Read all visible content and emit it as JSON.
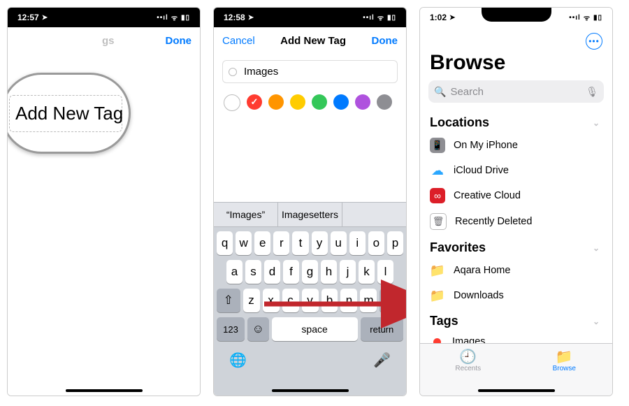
{
  "panel1": {
    "time": "12:57",
    "nav_done": "Done",
    "title_fragment": "gs",
    "magnified_text": "Add New Tag"
  },
  "panel2": {
    "time": "12:58",
    "nav_cancel": "Cancel",
    "nav_title": "Add New Tag",
    "nav_done": "Done",
    "input_value": "Images",
    "colors": [
      {
        "name": "none",
        "hex": "#ffffff",
        "hollow": true,
        "selected": false
      },
      {
        "name": "red",
        "hex": "#ff3b30",
        "selected": true
      },
      {
        "name": "orange",
        "hex": "#ff9500",
        "selected": false
      },
      {
        "name": "yellow",
        "hex": "#ffcc00",
        "selected": false
      },
      {
        "name": "green",
        "hex": "#34c759",
        "selected": false
      },
      {
        "name": "blue",
        "hex": "#007aff",
        "selected": false
      },
      {
        "name": "purple",
        "hex": "#af52de",
        "selected": false
      },
      {
        "name": "gray",
        "hex": "#8e8e93",
        "selected": false
      }
    ],
    "suggestions": [
      "“Images”",
      "Imagesetters",
      ""
    ],
    "kb_row1": [
      "q",
      "w",
      "e",
      "r",
      "t",
      "y",
      "u",
      "i",
      "o",
      "p"
    ],
    "kb_row2": [
      "a",
      "s",
      "d",
      "f",
      "g",
      "h",
      "j",
      "k",
      "l"
    ],
    "kb_row3": [
      "z",
      "x",
      "c",
      "v",
      "b",
      "n",
      "m"
    ],
    "kb_shift": "⇧",
    "kb_backspace": "⌫",
    "kb_123": "123",
    "kb_emoji": "☺",
    "kb_space": "space",
    "kb_return": "return",
    "kb_globe": "🌐",
    "kb_mic": "🎤"
  },
  "panel3": {
    "time": "1:02",
    "title": "Browse",
    "search_placeholder": "Search",
    "sections": {
      "locations_title": "Locations",
      "locations": [
        {
          "icon": "phone",
          "label": "On My iPhone"
        },
        {
          "icon": "cloud",
          "label": "iCloud Drive"
        },
        {
          "icon": "cc",
          "label": "Creative Cloud"
        },
        {
          "icon": "trash",
          "label": "Recently Deleted"
        }
      ],
      "favorites_title": "Favorites",
      "favorites": [
        {
          "icon": "folder",
          "label": "Aqara Home"
        },
        {
          "icon": "folder",
          "label": "Downloads"
        }
      ],
      "tags_title": "Tags",
      "tags": [
        {
          "color": "#ff3b30",
          "label": "Images"
        }
      ]
    },
    "tabs": {
      "recents": "Recents",
      "browse": "Browse"
    }
  }
}
